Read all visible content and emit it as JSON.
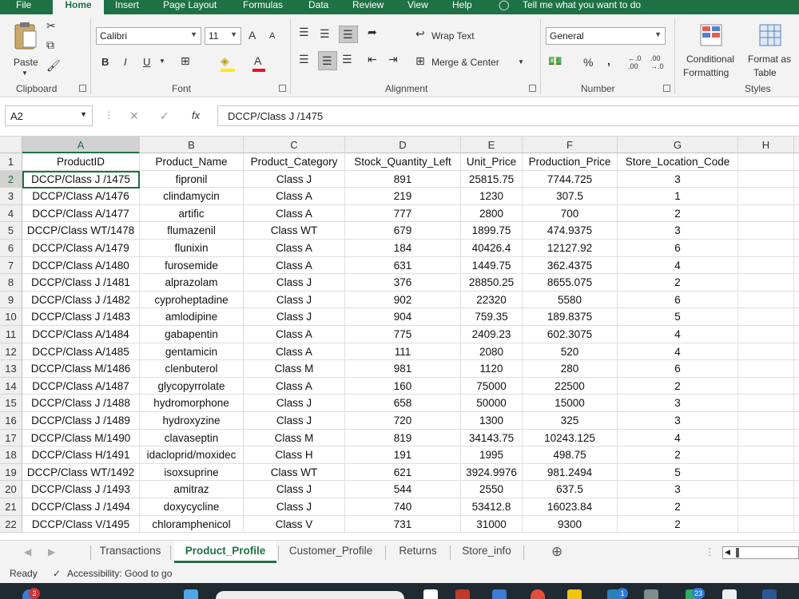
{
  "menu": {
    "tabs": [
      "File",
      "Home",
      "Insert",
      "Page Layout",
      "Formulas",
      "Data",
      "Review",
      "View",
      "Help"
    ],
    "active_tab": "Home",
    "tell_me": "Tell me what you want to do"
  },
  "ribbon": {
    "clipboard": {
      "paste": "Paste",
      "label": "Clipboard"
    },
    "font": {
      "name": "Calibri",
      "size": "11",
      "grow": "A",
      "shrink": "A",
      "bold": "B",
      "italic": "I",
      "underline": "U",
      "font_color_letter": "A",
      "label": "Font"
    },
    "alignment": {
      "wrap": "Wrap Text",
      "merge": "Merge & Center",
      "label": "Alignment"
    },
    "number": {
      "format": "General",
      "percent": "%",
      "comma": ",",
      "inc_dec": "←.0 .00",
      "dec_dec": ".00 →.0",
      "label": "Number"
    },
    "styles": {
      "cond1": "Conditional",
      "cond2": "Formatting",
      "fmt1": "Format as",
      "fmt2": "Table",
      "label": "Styles"
    }
  },
  "formula_bar": {
    "name_box": "A2",
    "formula": "DCCP/Class J /1475",
    "fx": "fx",
    "cancel": "✕",
    "enter": "✓"
  },
  "grid": {
    "columns": [
      "A",
      "B",
      "C",
      "D",
      "E",
      "F",
      "G",
      "H",
      "I"
    ],
    "rows": [
      [
        "1",
        "ProductID",
        "Product_Name",
        "Product_Category",
        "Stock_Quantity_Left",
        "Unit_Price",
        "Production_Price",
        "Store_Location_Code"
      ],
      [
        "2",
        "DCCP/Class J /1475",
        "fipronil",
        "Class J",
        "891",
        "25815.75",
        "7744.725",
        "3"
      ],
      [
        "3",
        "DCCP/Class A/1476",
        "clindamycin",
        "Class A",
        "219",
        "1230",
        "307.5",
        "1"
      ],
      [
        "4",
        "DCCP/Class A/1477",
        "artific",
        "Class A",
        "777",
        "2800",
        "700",
        "2"
      ],
      [
        "5",
        "DCCP/Class WT/1478",
        "flumazenil",
        "Class WT",
        "679",
        "1899.75",
        "474.9375",
        "3"
      ],
      [
        "6",
        "DCCP/Class A/1479",
        "flunixin",
        "Class A",
        "184",
        "40426.4",
        "12127.92",
        "6"
      ],
      [
        "7",
        "DCCP/Class A/1480",
        "furosemide",
        "Class A",
        "631",
        "1449.75",
        "362.4375",
        "4"
      ],
      [
        "8",
        "DCCP/Class J /1481",
        "alprazolam",
        "Class J",
        "376",
        "28850.25",
        "8655.075",
        "2"
      ],
      [
        "9",
        "DCCP/Class J /1482",
        "cyproheptadine",
        "Class J",
        "902",
        "22320",
        "5580",
        "6"
      ],
      [
        "10",
        "DCCP/Class J /1483",
        "amlodipine",
        "Class J",
        "904",
        "759.35",
        "189.8375",
        "5"
      ],
      [
        "11",
        "DCCP/Class A/1484",
        "gabapentin",
        "Class A",
        "775",
        "2409.23",
        "602.3075",
        "4"
      ],
      [
        "12",
        "DCCP/Class A/1485",
        "gentamicin",
        "Class A",
        "111",
        "2080",
        "520",
        "4"
      ],
      [
        "13",
        "DCCP/Class M/1486",
        "clenbuterol",
        "Class M",
        "981",
        "1120",
        "280",
        "6"
      ],
      [
        "14",
        "DCCP/Class A/1487",
        "glycopyrrolate",
        "Class A",
        "160",
        "75000",
        "22500",
        "2"
      ],
      [
        "15",
        "DCCP/Class J /1488",
        "hydromorphone",
        "Class J",
        "658",
        "50000",
        "15000",
        "3"
      ],
      [
        "16",
        "DCCP/Class J /1489",
        "hydroxyzine",
        "Class J",
        "720",
        "1300",
        "325",
        "3"
      ],
      [
        "17",
        "DCCP/Class M/1490",
        "clavaseptin",
        "Class M",
        "819",
        "34143.75",
        "10243.125",
        "4"
      ],
      [
        "18",
        "DCCP/Class H/1491",
        "idacloprid/moxidec",
        "Class H",
        "191",
        "1995",
        "498.75",
        "2"
      ],
      [
        "19",
        "DCCP/Class WT/1492",
        "isoxsuprine",
        "Class WT",
        "621",
        "3924.9976",
        "981.2494",
        "5"
      ],
      [
        "20",
        "DCCP/Class J /1493",
        "amitraz",
        "Class J",
        "544",
        "2550",
        "637.5",
        "3"
      ],
      [
        "21",
        "DCCP/Class J /1494",
        "doxycycline",
        "Class J",
        "740",
        "53412.8",
        "16023.84",
        "2"
      ],
      [
        "22",
        "DCCP/Class V/1495",
        "chloramphenicol",
        "Class V",
        "731",
        "31000",
        "9300",
        "2"
      ]
    ]
  },
  "sheet_tabs": [
    "Transactions",
    "Product_Profile",
    "Customer_Profile",
    "Returns",
    "Store_info"
  ],
  "active_sheet": "Product_Profile",
  "status": {
    "ready": "Ready",
    "accessibility": "Accessibility: Good to go"
  },
  "taskbar": {
    "badge_left": "2",
    "badge_mid": "1",
    "badge_right": "23"
  },
  "colors": {
    "excel_green": "#1e7145",
    "ribbon_bg": "#f3f3f3",
    "taskbar_bg": "#1f2a33"
  }
}
